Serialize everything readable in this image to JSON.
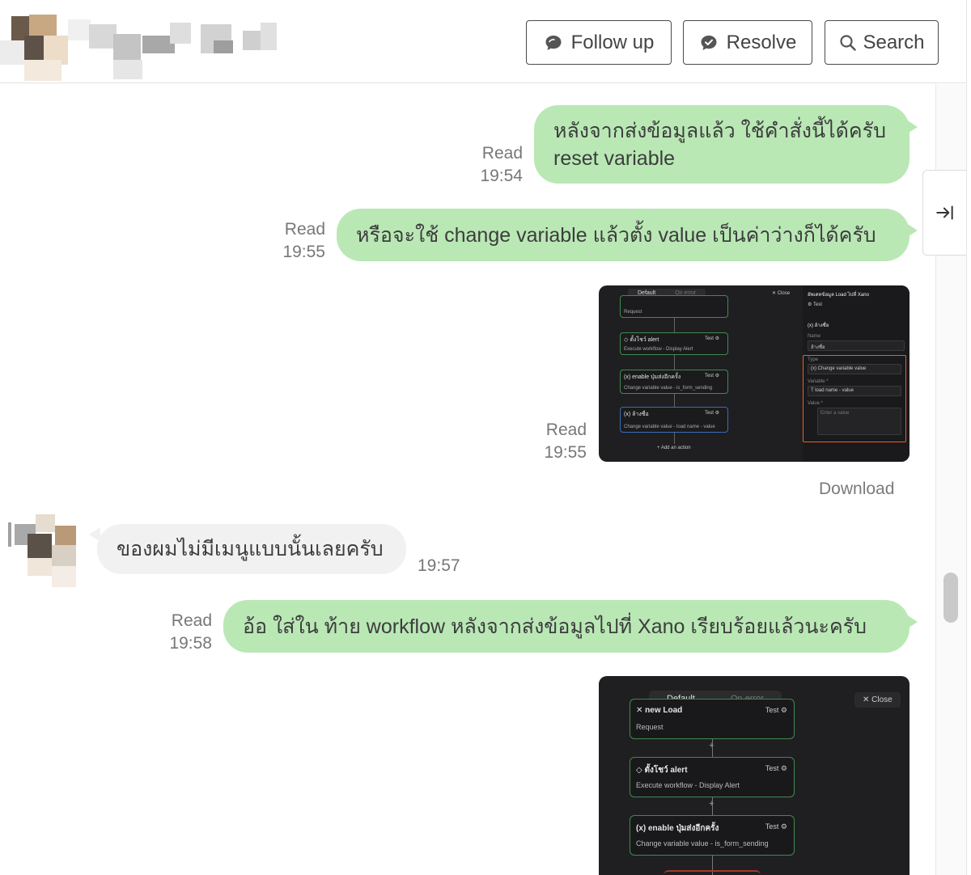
{
  "header": {
    "follow_up_label": "Follow up",
    "resolve_label": "Resolve",
    "search_label": "Search"
  },
  "messages": [
    {
      "line1": "หลังจากส่งข้อมูลแล้ว ใช้คำสั่งนี้ได้ครับ",
      "line2": "reset variable",
      "status": "Read",
      "time": "19:54"
    },
    {
      "text": "หรือจะใช้ change variable แล้วตั้ง value เป็นค่าว่างก็ได้ครับ",
      "status": "Read",
      "time": "19:55"
    },
    {
      "status": "Read",
      "time": "19:55",
      "download": "Download"
    },
    {
      "text": "ของผมไม่มีเมนูแบบนั้นเลยครับ",
      "time": "19:57"
    },
    {
      "text": "อ้อ ใส่ใน ท้าย workflow หลังจากส่งข้อมูลไปที่ Xano เรียบร้อยแล้วนะครับ",
      "status": "Read",
      "time": "19:58"
    }
  ],
  "screenshot1": {
    "tabs": [
      "Default",
      "On error"
    ],
    "close": "✕ Close",
    "nodes": [
      {
        "title": "Request"
      },
      {
        "title": "◇ ตั้งโชว์ alert",
        "sub": "Execute workflow - Display Alert",
        "badge": "Test ⚙"
      },
      {
        "title": "(x) enable ปุ่มส่งอีกครั้ง",
        "sub": "Change variable value - is_form_sending",
        "badge": "Test ⚙"
      },
      {
        "title": "(x) ล้างชื่อ",
        "sub": "Change variable value - load name - value",
        "badge": "Test ⚙"
      }
    ],
    "add_action": "+ Add an action",
    "panel": {
      "title": "อัพเดทข้อมูล Load ไปที่ Xano",
      "test": "⚙ Test",
      "section": "(x) ล้างชื่อ",
      "name_label": "Name",
      "name_value": "ล้างชื่อ",
      "type_label": "Type",
      "type_value": "(x) Change variable value",
      "variable_label": "Variable *",
      "variable_value": "T load name - value",
      "value_label": "Value *",
      "value_placeholder": "Enter a value"
    }
  },
  "screenshot2": {
    "tabs": [
      "Default",
      "On error"
    ],
    "close": "✕ Close",
    "nodes": [
      {
        "title": "✕ new Load",
        "sub": "Request",
        "badge": "Test ⚙"
      },
      {
        "title": "◇ ตั้งโชว์ alert",
        "sub": "Execute workflow - Display Alert",
        "badge": "Test ⚙"
      },
      {
        "title": "(x) enable ปุ่มส่งอีกครั้ง",
        "sub": "Change variable value - is_form_sending",
        "badge": "Test ⚙"
      }
    ]
  },
  "colors": {
    "outgoing_bubble": "#b9e8b5",
    "incoming_bubble": "#f1f1f1",
    "highlight": "#e4602f"
  }
}
